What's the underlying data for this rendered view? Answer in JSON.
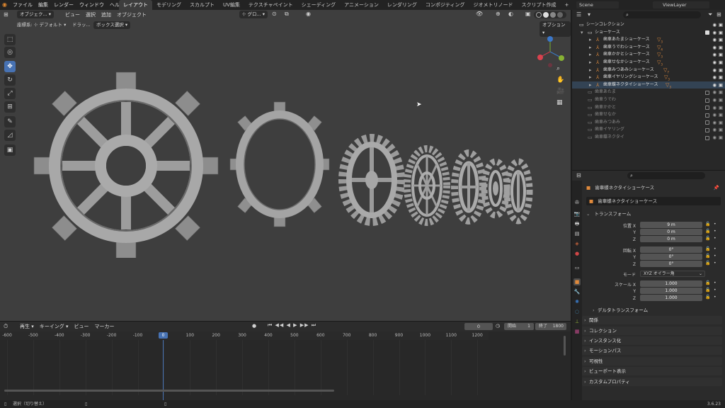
{
  "topbar": {
    "menus": [
      "ファイル",
      "編集",
      "レンダー",
      "ウィンドウ",
      "ヘルプ"
    ],
    "workspaces": [
      "レイアウト",
      "モデリング",
      "スカルプト",
      "UV編集",
      "テクスチャペイント",
      "シェーディング",
      "アニメーション",
      "レンダリング",
      "コンポジティング",
      "ジオメトリノード",
      "スクリプト作成"
    ],
    "active_workspace": "レイアウト",
    "scene": "Scene",
    "view_layer": "ViewLayer"
  },
  "viewport": {
    "mode": "オブジェク...",
    "menus": [
      "ビュー",
      "選択",
      "追加",
      "オブジェクト"
    ],
    "transform_orientation": "グロ...",
    "orientation_label": "座標系:",
    "orientation_value": "デフォルト",
    "drag_label": "ドラッ...",
    "select_box": "ボックス選択",
    "options": "オプション"
  },
  "timeline": {
    "menus": [
      "再生",
      "キーイング",
      "ビュー",
      "マーカー"
    ],
    "current_frame": "0",
    "start_label": "開始",
    "start_value": "1",
    "end_label": "終了",
    "end_value": "1800",
    "ruler": [
      "-600",
      "-500",
      "-400",
      "-300",
      "-200",
      "-100",
      "0",
      "100",
      "200",
      "300",
      "400",
      "500",
      "600",
      "700",
      "800",
      "900",
      "1000",
      "1100",
      "1200"
    ]
  },
  "status": {
    "hint": "選択（切り替え）",
    "version": "3.6.23"
  },
  "outliner": {
    "root": "シーンコレクション",
    "collection": "ショーケース",
    "children": [
      "歯車あたまショーケース",
      "歯車うでわショーケース",
      "歯車かかとショーケース",
      "歯車せなかショーケース",
      "歯車みつあみショーケース",
      "歯車イヤリングショーケース",
      "歯車蝶ネクタイショーケース"
    ],
    "badges": [
      "3",
      "4",
      "3",
      "3",
      "7",
      "3",
      "3"
    ],
    "others": [
      "歯車あたま",
      "歯車うでわ",
      "歯車かかと",
      "歯車せなか",
      "歯車みつあみ",
      "歯車イヤリング",
      "歯車蝶ネクタイ"
    ]
  },
  "properties": {
    "object_context": "歯車蝶ネクタイショーケース",
    "object_name": "歯車蝶ネクタイショーケース",
    "transform_header": "トランスフォーム",
    "location_label": "位置 X",
    "location": [
      "9 m",
      "0 m",
      "0 m"
    ],
    "rotation_label": "回転 X",
    "rotation": [
      "0°",
      "0°",
      "0°"
    ],
    "mode_label": "モード",
    "mode_value": "XYZ オイラー角",
    "scale_label": "スケール X",
    "scale": [
      "1.000",
      "1.000",
      "1.000"
    ],
    "axis_y": "Y",
    "axis_z": "Z",
    "sections": [
      "デルタトランスフォーム",
      "関係",
      "コレクション",
      "インスタンス化",
      "モーションパス",
      "可視性",
      "ビューポート表示",
      "カスタムプロパティ"
    ]
  },
  "colors": {
    "accent": "#4772b3",
    "object_orange": "#e08a3c",
    "gear": "#9c9c9c"
  }
}
